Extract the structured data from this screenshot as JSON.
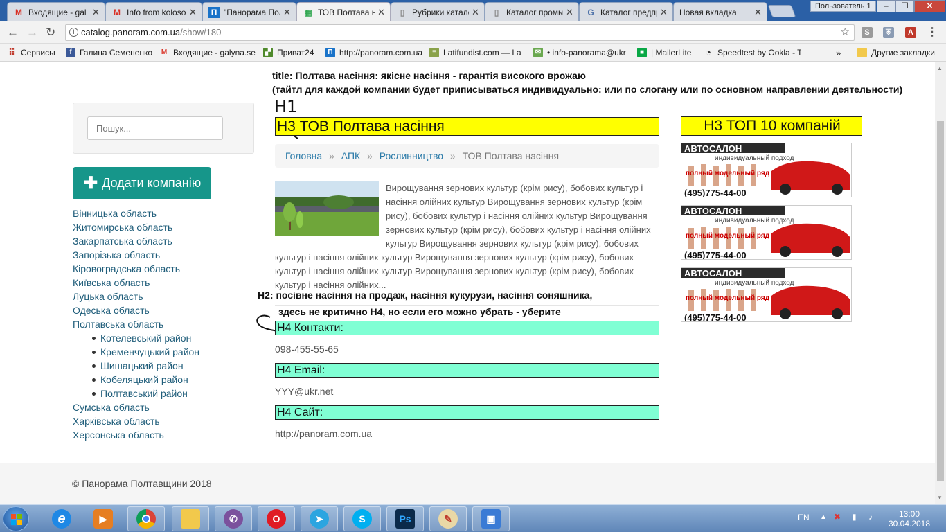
{
  "browser": {
    "tabs": [
      {
        "title": "Входящие - gal",
        "favicon": "gmail-icon",
        "color": "#d93025",
        "glyph": "M"
      },
      {
        "title": "Info from koloso",
        "favicon": "gmail-icon",
        "color": "#d93025",
        "glyph": "M"
      },
      {
        "title": "\"Панорама Пол",
        "favicon": "panorama-icon",
        "color": "#1a73c9",
        "glyph": "П"
      },
      {
        "title": "ТОВ Полтава н",
        "favicon": "google-icon",
        "color": "#34a853",
        "glyph": "▦",
        "active": true
      },
      {
        "title": "Рубрики катало",
        "favicon": "document-icon",
        "color": "#888888",
        "glyph": "▯"
      },
      {
        "title": "Каталог промы",
        "favicon": "document-icon",
        "color": "#888888",
        "glyph": "▯"
      },
      {
        "title": "Каталог предпр",
        "favicon": "g-icon",
        "color": "#4a6fa8",
        "glyph": "G"
      },
      {
        "title": "Новая вкладка",
        "favicon": "",
        "color": "",
        "glyph": ""
      }
    ],
    "user_label": "Пользователь 1",
    "url_host": "catalog.panoram.com.ua",
    "url_path": "/show/180",
    "bookmarks_label": "Сервисы",
    "bookmarks": [
      {
        "label": "Галина Семененко",
        "icon": "facebook-icon",
        "color": "#3b5998",
        "glyph": "f"
      },
      {
        "label": "Входящие - galyna.se",
        "icon": "gmail-icon",
        "color": "#d93025",
        "glyph": "M"
      },
      {
        "label": "Приват24",
        "icon": "privat24-icon",
        "color": "#4f8a2b",
        "glyph": "▞"
      },
      {
        "label": "http://panoram.com.ua",
        "icon": "panorama-icon",
        "color": "#1a73c9",
        "glyph": "П"
      },
      {
        "label": "Latifundist.com — La",
        "icon": "latifundist-icon",
        "color": "#8aa24a",
        "glyph": "≡"
      },
      {
        "label": "• info-panorama@ukr",
        "icon": "mail-icon",
        "color": "#6aa84f",
        "glyph": "✉"
      },
      {
        "label": "| MailerLite",
        "icon": "mailerlite-icon",
        "color": "#09a745",
        "glyph": "■"
      },
      {
        "label": "Speedtest by Ookla - T",
        "icon": "speedtest-icon",
        "color": "#333333",
        "glyph": "◔"
      }
    ],
    "other_bookmarks": "Другие закладки"
  },
  "annotations": {
    "title_line": "title: Полтава насіння: якісне насіння - гарантія високого врожаю",
    "title_note": "(тайтл для каждой компании будет приписываться индивидуально: или по слогану или по основном направлении деятельности)",
    "h1_mark": "H1",
    "h2_line": "H2: посівне насіння на продаж, насіння кукурузи, насіння соняшника,",
    "h4_note": "здесь не критично H4, но если его можно убрать - уберите"
  },
  "sidebar": {
    "search_placeholder": "Пошук...",
    "add_button": "Додати компанію",
    "regions": [
      {
        "label": "Вінницька область",
        "sub": false
      },
      {
        "label": "Житомирська область",
        "sub": false
      },
      {
        "label": "Закарпатська область",
        "sub": false
      },
      {
        "label": "Запорізька область",
        "sub": false
      },
      {
        "label": "Кіровоградська область",
        "sub": false
      },
      {
        "label": "Київська область",
        "sub": false
      },
      {
        "label": "Луцька область",
        "sub": false
      },
      {
        "label": "Одеська область",
        "sub": false
      },
      {
        "label": "Полтавська область",
        "sub": false
      },
      {
        "label": "Котелевський район",
        "sub": true
      },
      {
        "label": "Кременчуцький район",
        "sub": true
      },
      {
        "label": "Шишацький район",
        "sub": true
      },
      {
        "label": "Кобеляцький район",
        "sub": true
      },
      {
        "label": "Полтавський район",
        "sub": true
      },
      {
        "label": "Сумська область",
        "sub": false
      },
      {
        "label": "Харківська область",
        "sub": false
      },
      {
        "label": "Херсонська область",
        "sub": false
      }
    ]
  },
  "main": {
    "heading": "Н3 ТОВ Полтава насіння",
    "breadcrumb": {
      "home": "Головна",
      "level1": "АПК",
      "level2": "Рослинництво",
      "current": "ТОВ Полтава насіння",
      "separator": "»"
    },
    "description": "Вирощування зернових культур (крім рису), бобових культур і насіння олійних культур Вирощування зернових культур (крім рису), бобових культур і насіння олійних культур Вирощування зернових культур (крім рису), бобових культур і насіння олійних культур Вирощування зернових культур (крім рису), бобових культур і насіння олійних культур Вирощування зернових культур (крім рису), бобових культур і насіння олійних культур Вирощування зернових культур (крім рису), бобових культур і насіння олійних...",
    "contacts_heading": "Н4 Контакти:",
    "phone": "098-455-55-65",
    "email_heading": "Н4 Email:",
    "email": "YYY@ukr.net",
    "site_heading": "Н4 Сайт:",
    "site": "http://panoram.com.ua"
  },
  "right": {
    "heading": "Н3 ТОП 10 компаній",
    "ads": [
      {
        "brand": "АВТОСАЛОН",
        "tagline": "индивидуальный подход",
        "offer": "полный модельный ряд",
        "phone": "(495)775-44-00"
      },
      {
        "brand": "АВТОСАЛОН",
        "tagline": "индивидуальный подход",
        "offer": "полный модельный ряд",
        "phone": "(495)775-44-00"
      },
      {
        "brand": "АВТОСАЛОН",
        "tagline": "индивидуальный подход",
        "offer": "полный модельный ряд",
        "phone": "(495)775-44-00"
      }
    ]
  },
  "footer": {
    "copyright": "© Панорама Полтавщини 2018"
  },
  "taskbar": {
    "lang": "EN",
    "time": "13:00",
    "date": "30.04.2018"
  },
  "colors": {
    "teal": "#16968a",
    "h3_yellow": "#ffff00",
    "h4_mint": "#80ffd4",
    "link": "#2a7aa8",
    "region_link": "#1f5d7a"
  }
}
